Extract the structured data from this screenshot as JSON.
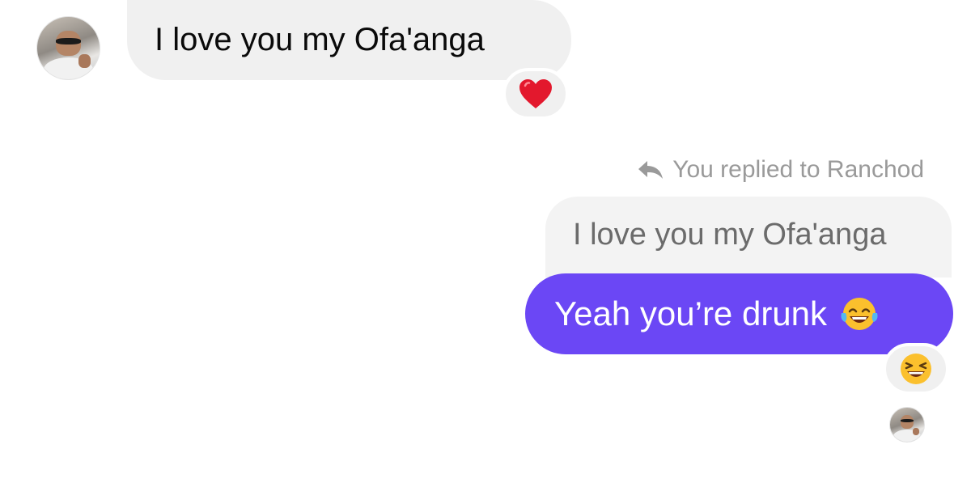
{
  "messages": {
    "incoming_text": "I love you my Ofa'anga",
    "incoming_reaction": "❤️",
    "reply_header": "You replied to Ranchod",
    "quoted_text": "I love you my Ofa'anga",
    "outgoing_text": "Yeah you’re drunk",
    "outgoing_inline_emoji": "😂",
    "outgoing_reaction": "😆"
  },
  "icons": {
    "reply": "reply-arrow-icon",
    "heart": "heart-icon",
    "laughing": "laughing-face-icon",
    "tears_of_joy": "tears-of-joy-icon"
  },
  "colors": {
    "outgoing_bubble": "#6b47f5",
    "incoming_bubble": "#f0f0f0",
    "meta_text": "#9a9a9a",
    "heart": "#e3182d",
    "emoji_yellow": "#fbc02d"
  }
}
